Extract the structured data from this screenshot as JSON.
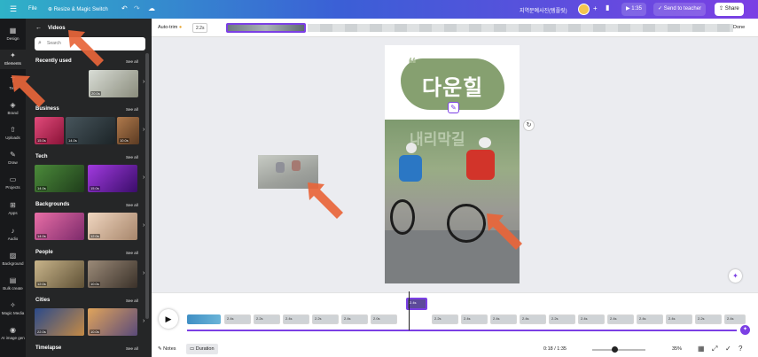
{
  "topbar": {
    "menu_icon": "menu-icon",
    "file_label": "File",
    "resize_label": "Resize & Magic Switch",
    "undo_icon": "undo-icon",
    "redo_icon": "redo-icon",
    "cloud_icon": "cloud-icon",
    "doc_title": "지역문예사진(템플릿)",
    "play_label": "1:35",
    "send_label": "Send to teacher",
    "share_label": "Share"
  },
  "rail": {
    "items": [
      {
        "label": "Design",
        "icon": "design-icon"
      },
      {
        "label": "Elements",
        "icon": "elements-icon"
      },
      {
        "label": "Text",
        "icon": "text-icon"
      },
      {
        "label": "Brand",
        "icon": "brand-icon"
      },
      {
        "label": "Uploads",
        "icon": "upload-icon"
      },
      {
        "label": "Draw",
        "icon": "draw-icon"
      },
      {
        "label": "Projects",
        "icon": "folder-icon"
      },
      {
        "label": "Apps",
        "icon": "apps-icon"
      },
      {
        "label": "Audio",
        "icon": "audio-icon"
      },
      {
        "label": "Background",
        "icon": "background-icon"
      },
      {
        "label": "Bulk create",
        "icon": "bulk-icon"
      },
      {
        "label": "Magic Media",
        "icon": "magic-icon"
      },
      {
        "label": "AI image gen",
        "icon": "ai-icon"
      }
    ]
  },
  "panel": {
    "header": "Videos",
    "search_placeholder": "Search",
    "see_all": "See all",
    "sections": [
      {
        "title": "Recently used",
        "durations": [
          "20.0s"
        ]
      },
      {
        "title": "Business",
        "durations": [
          "15.0s",
          "14.0s",
          "10.0s"
        ]
      },
      {
        "title": "Tech",
        "durations": [
          "14.0s",
          "15.0s"
        ]
      },
      {
        "title": "Backgrounds",
        "durations": [
          "14.0s",
          "12.0s"
        ]
      },
      {
        "title": "People",
        "durations": [
          "12.0s",
          "10.0s"
        ]
      },
      {
        "title": "Cities",
        "durations": [
          "22.0s",
          "10.0s"
        ]
      },
      {
        "title": "Timelapse",
        "durations": []
      }
    ]
  },
  "canvasbar": {
    "autotrim_label": "Auto-trim",
    "duration_value": "2.2s",
    "done_label": "Done"
  },
  "canvas": {
    "title_text": "다운힐",
    "subtitle_text": "내리막길"
  },
  "timeline": {
    "frame_durations": [
      "2.2s",
      "2.4s",
      "2.2s",
      "2.4s",
      "2.2s",
      "2.4s",
      "2.0s",
      "2.4s",
      "2.2s",
      "2.4s",
      "2.4s",
      "2.4s",
      "2.2s",
      "2.4s",
      "2.4s",
      "2.4s",
      "2.4s",
      "2.2s",
      "2.4s",
      "2.4s"
    ],
    "notes_label": "Notes",
    "duration_label": "Duration",
    "time_readout": "0:18 / 1:35",
    "zoom_label": "35%"
  },
  "colors": {
    "accent": "#7b3fe4",
    "panel_bg": "#252627",
    "rail_bg": "#18191b",
    "annotation_arrow": "#e8653a",
    "title_pill": "#86a070"
  }
}
